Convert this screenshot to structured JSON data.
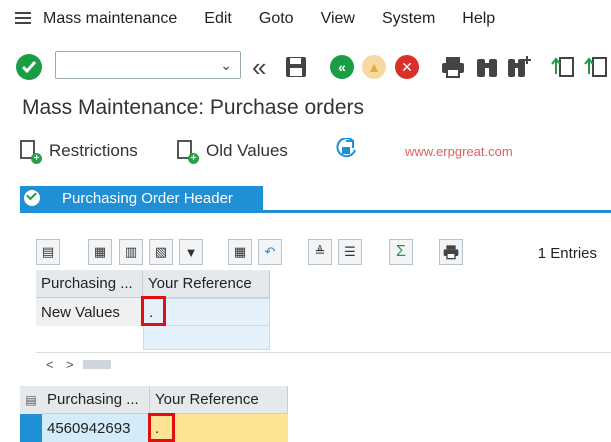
{
  "menu": {
    "items": [
      {
        "label": "Mass maintenance"
      },
      {
        "label": "Edit"
      },
      {
        "label": "Goto"
      },
      {
        "label": "View"
      },
      {
        "label": "System"
      },
      {
        "label": "Help"
      }
    ]
  },
  "toolbar": {
    "command_value": "",
    "dropdown_glyph": "⌄",
    "back_glyph": "«",
    "exit_glyph": "▲",
    "cancel_glyph": "✕",
    "nav_glyph": "«"
  },
  "page": {
    "title": "Mass Maintenance: Purchase orders"
  },
  "app_toolbar": {
    "restrictions_label": "Restrictions",
    "old_values_label": "Old Values",
    "watermark": "www.erpgreat.com"
  },
  "tab": {
    "label": "Purchasing Order Header"
  },
  "grid_toolbar": {
    "entries_label": "1 Entries",
    "sum_glyph": "Σ"
  },
  "upper_grid": {
    "headers": [
      "Purchasing ...",
      "Your Reference"
    ],
    "row_label": "New Values",
    "new_reference_value": "."
  },
  "scroll": {
    "left": "<",
    "right": ">"
  },
  "lower_grid": {
    "headers": [
      "Purchasing ...",
      "Your Reference"
    ],
    "rows": [
      {
        "po_number": "4560942693",
        "reference": "."
      }
    ]
  },
  "colors": {
    "accent": "#1f8fd6",
    "ok_green": "#1a9e45",
    "cancel_red": "#d9302a",
    "highlight_red": "#e01010",
    "reference_cell": "#fde394"
  }
}
